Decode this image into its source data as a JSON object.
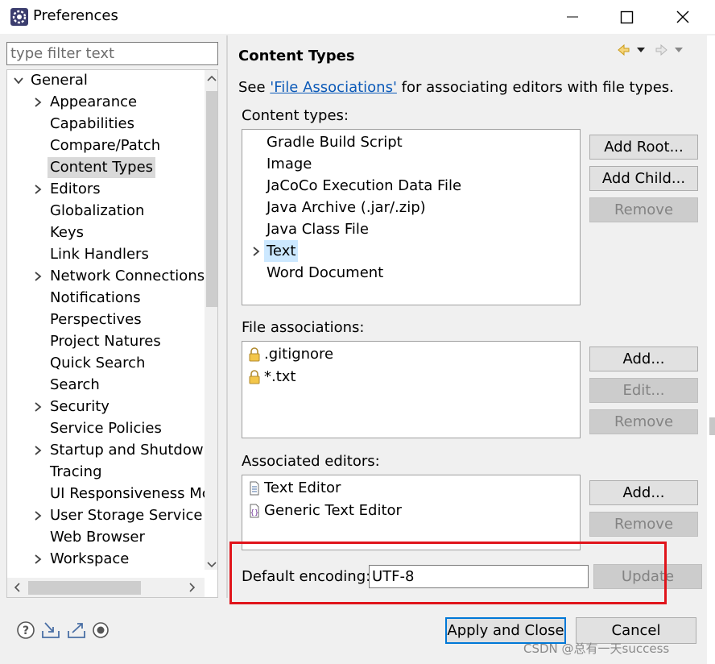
{
  "window": {
    "title": "Preferences"
  },
  "filter": {
    "placeholder": "type filter text"
  },
  "tree": {
    "items": [
      {
        "label": "General",
        "expand": "down"
      },
      {
        "label": "Appearance",
        "expand": "right"
      },
      {
        "label": "Capabilities",
        "expand": "none"
      },
      {
        "label": "Compare/Patch",
        "expand": "none"
      },
      {
        "label": "Content Types",
        "expand": "none",
        "selected": true
      },
      {
        "label": "Editors",
        "expand": "right"
      },
      {
        "label": "Globalization",
        "expand": "none"
      },
      {
        "label": "Keys",
        "expand": "none"
      },
      {
        "label": "Link Handlers",
        "expand": "none"
      },
      {
        "label": "Network Connections",
        "expand": "right"
      },
      {
        "label": "Notifications",
        "expand": "none"
      },
      {
        "label": "Perspectives",
        "expand": "none"
      },
      {
        "label": "Project Natures",
        "expand": "none"
      },
      {
        "label": "Quick Search",
        "expand": "none"
      },
      {
        "label": "Search",
        "expand": "none"
      },
      {
        "label": "Security",
        "expand": "right"
      },
      {
        "label": "Service Policies",
        "expand": "none"
      },
      {
        "label": "Startup and Shutdow",
        "expand": "right"
      },
      {
        "label": "Tracing",
        "expand": "none"
      },
      {
        "label": "UI Responsiveness Mc",
        "expand": "none"
      },
      {
        "label": "User Storage Service",
        "expand": "right"
      },
      {
        "label": "Web Browser",
        "expand": "none"
      },
      {
        "label": "Workspace",
        "expand": "right"
      }
    ]
  },
  "page": {
    "title": "Content Types",
    "see_prefix": "See ",
    "see_link": "'File Associations'",
    "see_suffix": " for associating editors with file types."
  },
  "content_types": {
    "label": "Content types:",
    "items": [
      {
        "label": "Gradle Build Script"
      },
      {
        "label": "Image"
      },
      {
        "label": "JaCoCo Execution Data File"
      },
      {
        "label": "Java Archive (.jar/.zip)"
      },
      {
        "label": "Java Class File"
      },
      {
        "label": "Text",
        "selected": true,
        "expandable": true
      },
      {
        "label": "Word Document"
      }
    ],
    "buttons": {
      "add_root": "Add Root...",
      "add_child": "Add Child...",
      "remove": "Remove"
    }
  },
  "file_associations": {
    "label": "File associations:",
    "items": [
      {
        "label": ".gitignore",
        "icon": "lock-icon"
      },
      {
        "label": "*.txt",
        "icon": "lock-icon"
      }
    ],
    "buttons": {
      "add": "Add...",
      "edit": "Edit...",
      "remove": "Remove"
    }
  },
  "associated_editors": {
    "label": "Associated editors:",
    "items": [
      {
        "label": "Text Editor",
        "icon": "text-file-icon"
      },
      {
        "label": "Generic Text Editor",
        "icon": "generic-editor-icon"
      }
    ],
    "buttons": {
      "add": "Add...",
      "remove": "Remove"
    }
  },
  "encoding": {
    "label": "Default encoding:",
    "value": "UTF-8",
    "update": "Update"
  },
  "footer": {
    "apply_close": "Apply and Close",
    "cancel": "Cancel"
  },
  "watermark": "CSDN @总有一天success",
  "colors": {
    "selection": "#cce8ff",
    "link": "#0c5ab8",
    "highlight": "#e0141b",
    "primary_border": "#0078d7"
  }
}
